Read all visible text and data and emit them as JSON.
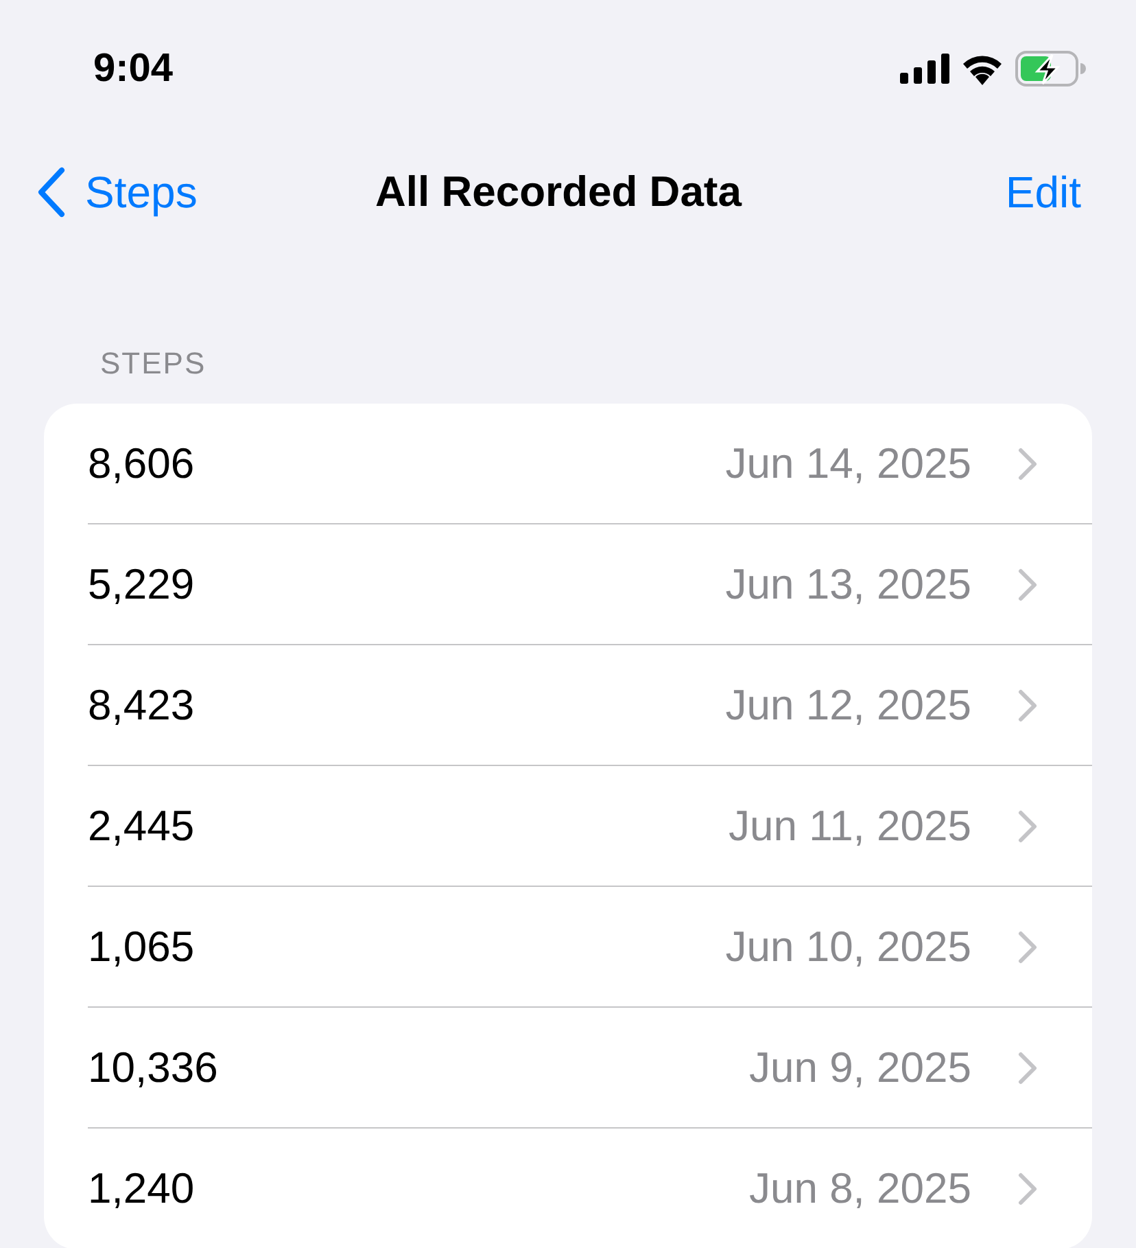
{
  "status_bar": {
    "time": "9:04"
  },
  "nav": {
    "back": "Steps",
    "title": "All Recorded Data",
    "action": "Edit"
  },
  "section": {
    "header": "STEPS",
    "rows": [
      {
        "value": "8,606",
        "date": "Jun 14, 2025"
      },
      {
        "value": "5,229",
        "date": "Jun 13, 2025"
      },
      {
        "value": "8,423",
        "date": "Jun 12, 2025"
      },
      {
        "value": "2,445",
        "date": "Jun 11, 2025"
      },
      {
        "value": "1,065",
        "date": "Jun 10, 2025"
      },
      {
        "value": "10,336",
        "date": "Jun 9, 2025"
      },
      {
        "value": "1,240",
        "date": "Jun 8, 2025"
      }
    ]
  }
}
